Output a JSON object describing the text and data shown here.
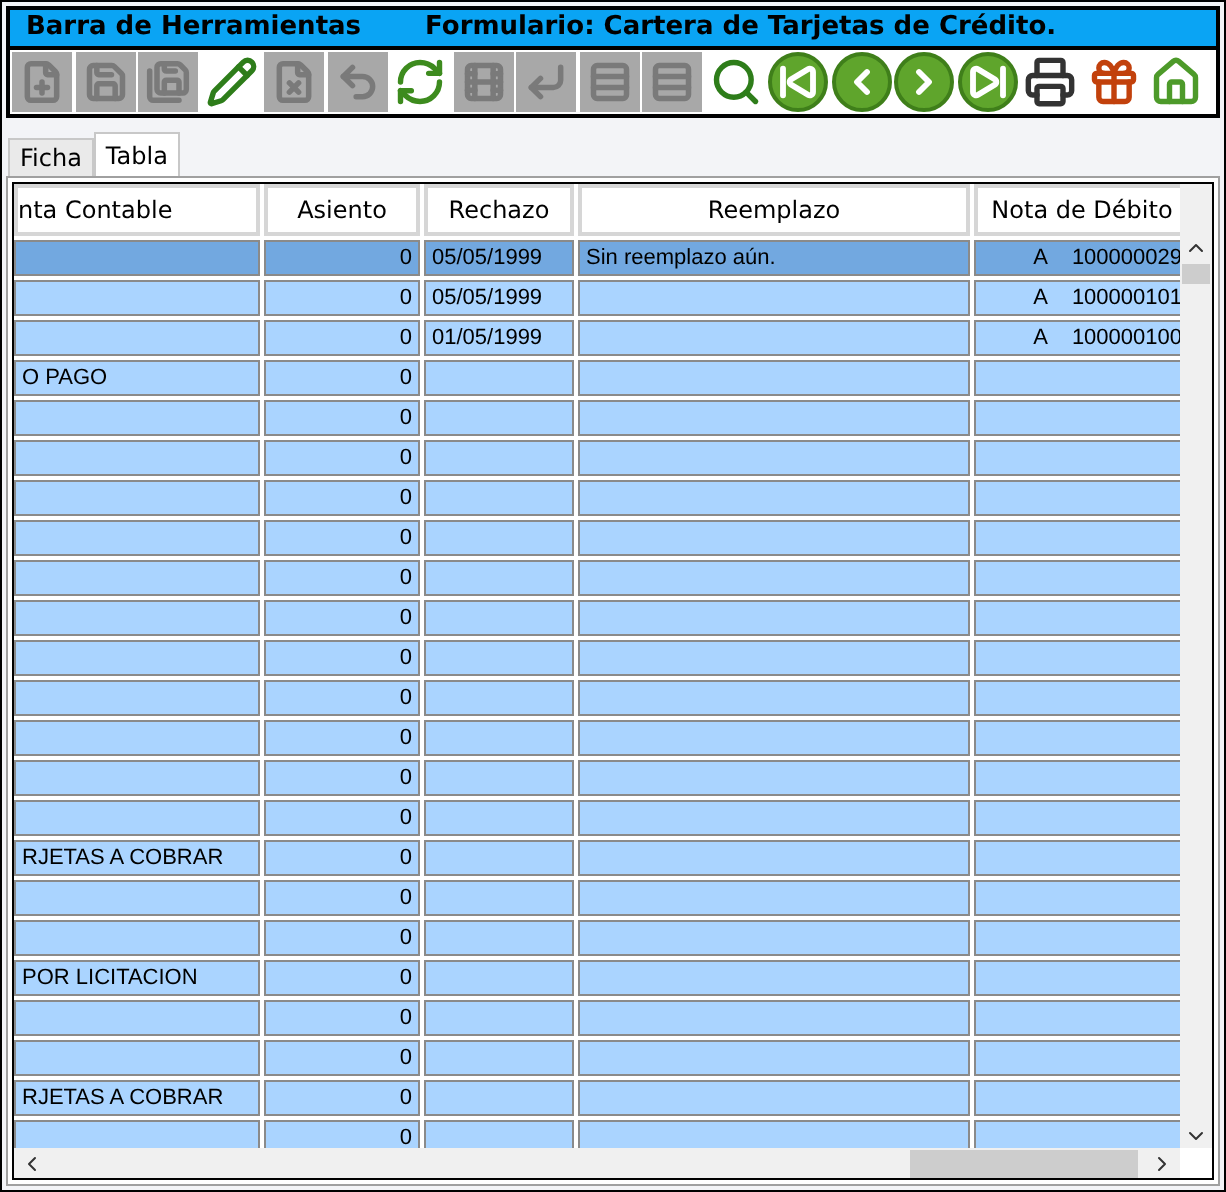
{
  "window": {
    "title": "Barra de Herramientas",
    "form_title": "Formulario: Cartera de Tarjetas de Crédito."
  },
  "toolbar": {
    "buttons": [
      {
        "kind": "new",
        "disabled": true
      },
      {
        "kind": "save",
        "disabled": true
      },
      {
        "kind": "save-as",
        "disabled": true
      },
      {
        "kind": "edit",
        "disabled": false
      },
      {
        "kind": "delete",
        "disabled": true
      },
      {
        "kind": "undo",
        "disabled": true
      },
      {
        "kind": "refresh",
        "disabled": false
      },
      {
        "kind": "film",
        "disabled": true
      },
      {
        "kind": "back",
        "disabled": true
      },
      {
        "kind": "list",
        "disabled": true
      },
      {
        "kind": "list",
        "disabled": true
      },
      {
        "kind": "search",
        "disabled": false
      },
      {
        "kind": "first",
        "disabled": false
      },
      {
        "kind": "prev",
        "disabled": false
      },
      {
        "kind": "next",
        "disabled": false
      },
      {
        "kind": "last",
        "disabled": false
      },
      {
        "kind": "print",
        "disabled": false
      },
      {
        "kind": "gift",
        "disabled": false
      },
      {
        "kind": "home",
        "disabled": false
      }
    ]
  },
  "tabs": [
    {
      "label": "Ficha",
      "selected": false
    },
    {
      "label": "Tabla",
      "selected": true
    }
  ],
  "table": {
    "columns": [
      "nta Contable",
      "Asiento",
      "Rechazo",
      "Reemplazo",
      "Nota de Débito"
    ],
    "rows": [
      {
        "cuenta": "",
        "asiento": "0",
        "rechazo": "05/05/1999",
        "reemplazo": "Sin reemplazo aún.",
        "nota_letra": "A",
        "nota_numero": "100000029",
        "selected": true
      },
      {
        "cuenta": "",
        "asiento": "0",
        "rechazo": "05/05/1999",
        "reemplazo": "",
        "nota_letra": "A",
        "nota_numero": "100000101",
        "selected": false
      },
      {
        "cuenta": "",
        "asiento": "0",
        "rechazo": "01/05/1999",
        "reemplazo": "",
        "nota_letra": "A",
        "nota_numero": "100000100",
        "selected": false
      },
      {
        "cuenta": "O PAGO",
        "asiento": "0",
        "selected": false
      },
      {
        "cuenta": "",
        "asiento": "0",
        "selected": false
      },
      {
        "cuenta": "",
        "asiento": "0",
        "selected": false
      },
      {
        "cuenta": "",
        "asiento": "0",
        "selected": false
      },
      {
        "cuenta": "",
        "asiento": "0",
        "selected": false
      },
      {
        "cuenta": "",
        "asiento": "0",
        "selected": false
      },
      {
        "cuenta": "",
        "asiento": "0",
        "selected": false
      },
      {
        "cuenta": "",
        "asiento": "0",
        "selected": false
      },
      {
        "cuenta": "",
        "asiento": "0",
        "selected": false
      },
      {
        "cuenta": "",
        "asiento": "0",
        "selected": false
      },
      {
        "cuenta": "",
        "asiento": "0",
        "selected": false
      },
      {
        "cuenta": "",
        "asiento": "0",
        "selected": false
      },
      {
        "cuenta": "RJETAS A COBRAR",
        "asiento": "0",
        "selected": false
      },
      {
        "cuenta": "",
        "asiento": "0",
        "selected": false
      },
      {
        "cuenta": "",
        "asiento": "0",
        "selected": false
      },
      {
        "cuenta": "POR LICITACION",
        "asiento": "0",
        "selected": false
      },
      {
        "cuenta": "",
        "asiento": "0",
        "selected": false
      },
      {
        "cuenta": "",
        "asiento": "0",
        "selected": false
      },
      {
        "cuenta": "RJETAS A COBRAR",
        "asiento": "0",
        "selected": false
      },
      {
        "cuenta": "",
        "asiento": "0",
        "selected": false
      }
    ]
  }
}
